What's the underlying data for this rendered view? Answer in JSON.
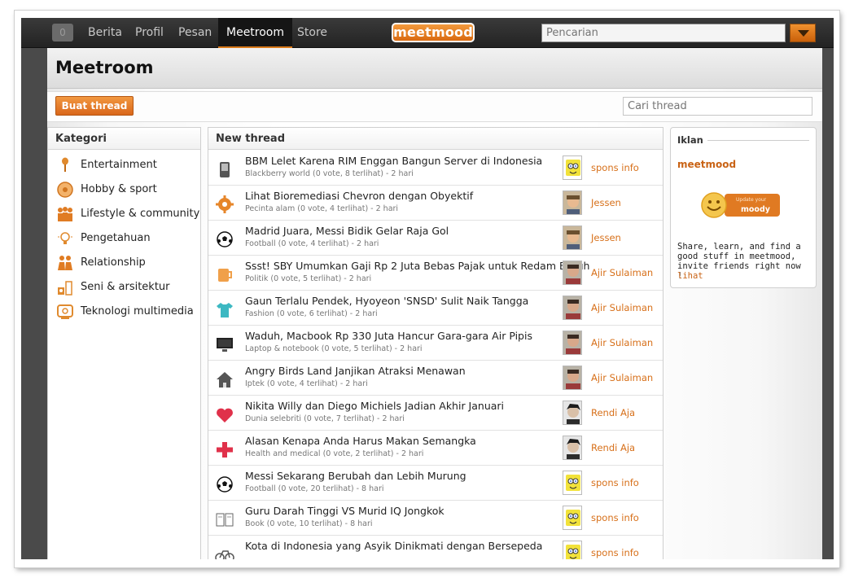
{
  "topbar": {
    "notif_count": "0",
    "nav": [
      "Berita",
      "Profil",
      "Pesan",
      "Meetroom",
      "Store"
    ],
    "logo": "meetmood",
    "search_placeholder": "Pencarian"
  },
  "page": {
    "title": "Meetroom",
    "create_button": "Buat thread",
    "search_thread_placeholder": "Cari thread"
  },
  "categories": {
    "heading": "Kategori",
    "items": [
      {
        "label": "Entertainment",
        "icon": "microphone-icon"
      },
      {
        "label": "Hobby & sport",
        "icon": "ball-icon"
      },
      {
        "label": "Lifestyle & community",
        "icon": "people-icon"
      },
      {
        "label": "Pengetahuan",
        "icon": "lightbulb-icon"
      },
      {
        "label": "Relationship",
        "icon": "couple-icon"
      },
      {
        "label": "Seni & arsitektur",
        "icon": "building-icon"
      },
      {
        "label": "Teknologi multimedia",
        "icon": "tv-icon"
      }
    ]
  },
  "threads": {
    "heading": "New thread",
    "items": [
      {
        "title": "BBM Lelet Karena RIM Enggan Bangun Server di Indonesia",
        "meta": "Blackberry world  (0 vote, 8 terlihat)  - 2 hari",
        "user": "spons info",
        "icon": "phone-icon"
      },
      {
        "title": "Lihat Bioremediasi Chevron dengan Obyektif",
        "meta": "Pecinta alam  (0 vote, 4 terlihat)  - 2 hari",
        "user": "Jessen",
        "icon": "gear-icon"
      },
      {
        "title": "Madrid Juara, Messi Bidik Gelar Raja Gol",
        "meta": "Football  (0 vote, 4 terlihat)  - 2 hari",
        "user": "Jessen",
        "icon": "soccer-ball-icon"
      },
      {
        "title": "Ssst! SBY Umumkan Gaji Rp 2 Juta Bebas Pajak untuk Redam Buruh",
        "meta": "Politik  (0 vote, 5 terlihat)  - 2 hari",
        "user": "Ajir Sulaiman",
        "icon": "mug-icon"
      },
      {
        "title": "Gaun Terlalu Pendek, Hyoyeon 'SNSD' Sulit Naik Tangga",
        "meta": "Fashion  (0 vote, 6 terlihat)  - 2 hari",
        "user": "Ajir Sulaiman",
        "icon": "tshirt-icon"
      },
      {
        "title": "Waduh, Macbook Rp 330 Juta Hancur Gara-gara Air Pipis",
        "meta": "Laptop & notebook  (0 vote, 5 terlihat)  - 2 hari",
        "user": "Ajir Sulaiman",
        "icon": "monitor-icon"
      },
      {
        "title": "Angry Birds Land Janjikan Atraksi Menawan",
        "meta": "Iptek  (0 vote, 4 terlihat)  - 2 hari",
        "user": "Ajir Sulaiman",
        "icon": "house-icon"
      },
      {
        "title": "Nikita Willy dan Diego Michiels Jadian Akhir Januari",
        "meta": "Dunia selebriti  (0 vote, 7 terlihat)  - 2 hari",
        "user": "Rendi Aja",
        "icon": "heart-icon"
      },
      {
        "title": "Alasan Kenapa Anda Harus Makan Semangka",
        "meta": "Health and medical  (0 vote, 2 terlihat)  - 2 hari",
        "user": "Rendi Aja",
        "icon": "medical-cross-icon"
      },
      {
        "title": "Messi Sekarang Berubah dan Lebih Murung",
        "meta": "Football  (0 vote, 20 terlihat)  - 8 hari",
        "user": "spons info",
        "icon": "soccer-ball-icon"
      },
      {
        "title": "Guru Darah Tinggi VS Murid IQ Jongkok",
        "meta": "Book  (0 vote, 10 terlihat)  - 8 hari",
        "user": "spons info",
        "icon": "book-icon"
      },
      {
        "title": "Kota di Indonesia yang Asyik Dinikmati dengan Bersepeda",
        "meta": "",
        "user": "spons info",
        "icon": "bicycle-icon"
      }
    ]
  },
  "ad": {
    "heading": "Iklan",
    "brand": "meetmood",
    "badge_small": "Update your",
    "badge_big": "moody",
    "text": "Share, learn, and find a good stuff in meetmood, invite friends right now !",
    "link": "lihat"
  },
  "colors": {
    "accent": "#d7701a",
    "topbar": "#2a2a2a"
  }
}
